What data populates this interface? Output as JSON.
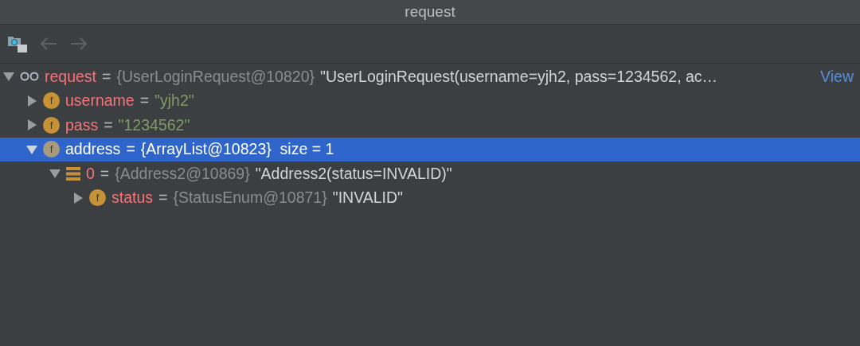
{
  "window": {
    "title": "request"
  },
  "toolbar": [
    {
      "kind": "frames",
      "disabled": false
    },
    {
      "kind": "back",
      "disabled": true
    },
    {
      "kind": "forward",
      "disabled": true
    }
  ],
  "tree": [
    {
      "kind": "watch",
      "name": "request",
      "op": "=",
      "ref": "{UserLoginRequest@10820}",
      "value": {
        "kind": "object",
        "text": "\"UserLoginRequest(username=yjh2, pass=1234562, ac…"
      },
      "link": "View",
      "expanded": true,
      "selected": false,
      "children": [
        {
          "kind": "field",
          "badge": "f",
          "name": "username",
          "op": "=",
          "value": {
            "kind": "string",
            "text": "\"yjh2\""
          },
          "expanded": false,
          "selected": false
        },
        {
          "kind": "field",
          "badge": "f",
          "name": "pass",
          "op": "=",
          "value": {
            "kind": "string",
            "text": "\"1234562\""
          },
          "expanded": false,
          "selected": false
        },
        {
          "kind": "field",
          "badge": "f",
          "name": "address",
          "op": "=",
          "value": {
            "kind": "object",
            "text": "{ArrayList@10823}  size = 1"
          },
          "expanded": true,
          "selected": true,
          "children": [
            {
              "kind": "element",
              "name": "0",
              "op": "=",
              "ref": "{Address2@10869}",
              "value": {
                "kind": "object",
                "text": "\"Address2(status=INVALID)\""
              },
              "expanded": true,
              "selected": false,
              "children": [
                {
                  "kind": "field",
                  "badge": "f",
                  "name": "status",
                  "op": "=",
                  "ref": "{StatusEnum@10871}",
                  "value": {
                    "kind": "object",
                    "text": "\"INVALID\""
                  },
                  "expanded": false,
                  "selected": false
                }
              ]
            }
          ]
        }
      ]
    }
  ]
}
